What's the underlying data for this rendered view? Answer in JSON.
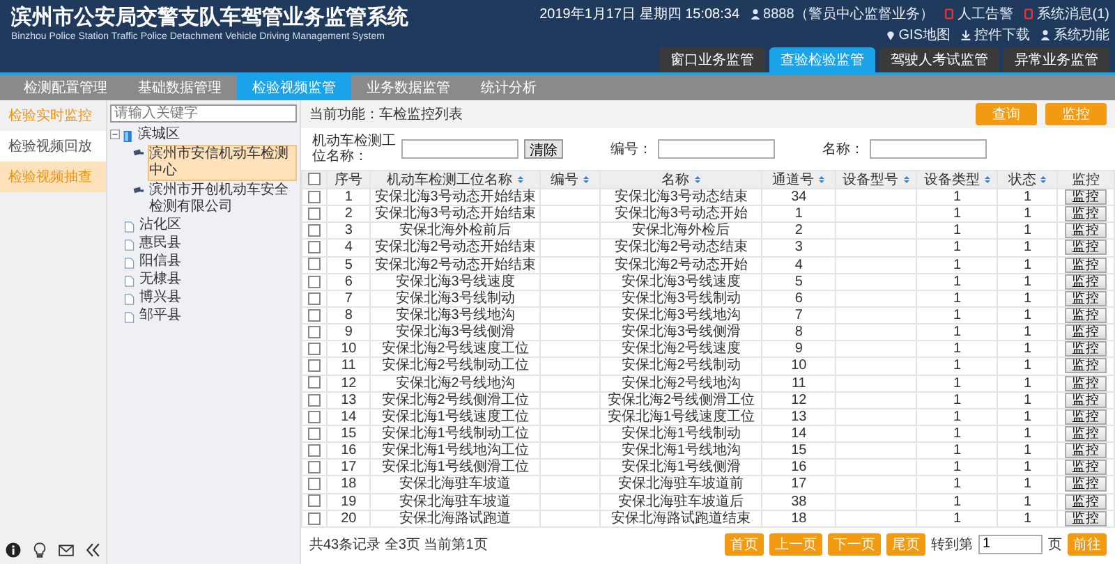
{
  "header": {
    "title": "滨州市公安局交警支队车驾管业务监管系统",
    "subtitle": "Binzhou Police Station Traffic Police Detachment Vehicle Driving Management System",
    "datetime": "2019年1月17日 星期四 15:08:34",
    "links": [
      {
        "kind": "user",
        "label": "8888（警员中心监督业务）"
      },
      {
        "kind": "alarm",
        "label": "人工告警"
      },
      {
        "kind": "message",
        "label": "系统消息(1)"
      },
      {
        "kind": "map",
        "label": "GIS地图"
      },
      {
        "kind": "download",
        "label": "控件下载"
      },
      {
        "kind": "system",
        "label": "系统功能"
      }
    ],
    "tabs": [
      {
        "label": "窗口业务监管",
        "selected": false
      },
      {
        "label": "查验检验监管",
        "selected": true
      },
      {
        "label": "驾驶人考试监管",
        "selected": false
      },
      {
        "label": "异常业务监管",
        "selected": false
      }
    ]
  },
  "nav": {
    "tabs": [
      {
        "label": "检测配置管理",
        "selected": false
      },
      {
        "label": "基础数据管理",
        "selected": false
      },
      {
        "label": "检验视频监管",
        "selected": true
      },
      {
        "label": "业务数据监管",
        "selected": false
      },
      {
        "label": "统计分析",
        "selected": false
      }
    ]
  },
  "sidebar": {
    "items": [
      {
        "label": "检验实时监控",
        "selected": false,
        "hover": true
      },
      {
        "label": "检验视频回放",
        "selected": false,
        "hover": false
      },
      {
        "label": "检验视频抽查",
        "selected": true,
        "hover": false
      }
    ]
  },
  "tree": {
    "placeholder": "请输入关键字",
    "nodes": [
      {
        "label": "滨城区",
        "expanded": true,
        "children": [
          {
            "label": "滨州市安信机动车检测中心",
            "selected": true
          },
          {
            "label": "滨州市开创机动车安全检测有限公司",
            "selected": false
          }
        ]
      },
      {
        "label": "沾化区"
      },
      {
        "label": "惠民县"
      },
      {
        "label": "阳信县"
      },
      {
        "label": "无棣县"
      },
      {
        "label": "博兴县"
      },
      {
        "label": "邹平县"
      }
    ]
  },
  "main": {
    "breadcrumb": "当前功能：车检监控列表",
    "actions": [
      "查询",
      "监控"
    ],
    "filters": [
      {
        "label": "机动车检测工位名称：",
        "button": "清除"
      },
      {
        "label": "编号："
      },
      {
        "label": "名称："
      }
    ],
    "table": {
      "select_all": {
        "checked": false
      },
      "columns": [
        {
          "label": "序号",
          "sortable": false
        },
        {
          "label": "机动车检测工位名称",
          "sortable": true
        },
        {
          "label": "编号",
          "sortable": true
        },
        {
          "label": "名称",
          "sortable": true
        },
        {
          "label": "通道号",
          "sortable": true
        },
        {
          "label": "设备型号",
          "sortable": true
        },
        {
          "label": "设备类型",
          "sortable": true
        },
        {
          "label": "状态",
          "sortable": true
        },
        {
          "label": "监控",
          "sortable": false
        }
      ],
      "rows": [
        {
          "checked": false,
          "index": "1",
          "station": "安保北海3号动态开始结束",
          "name": "安保北海3号动态结束",
          "channel": "34",
          "device_type": "1",
          "status": "1",
          "action": "监控"
        },
        {
          "checked": false,
          "index": "2",
          "station": "安保北海3号动态开始结束",
          "name": "安保北海3号动态开始",
          "channel": "1",
          "device_type": "1",
          "status": "1",
          "action": "监控"
        },
        {
          "checked": false,
          "index": "3",
          "station": "安保北海外检前后",
          "name": "安保北海外检后",
          "channel": "2",
          "device_type": "1",
          "status": "1",
          "action": "监控"
        },
        {
          "checked": false,
          "index": "4",
          "station": "安保北海2号动态开始结束",
          "name": "安保北海2号动态结束",
          "channel": "3",
          "device_type": "1",
          "status": "1",
          "action": "监控"
        },
        {
          "checked": false,
          "index": "5",
          "station": "安保北海2号动态开始结束",
          "name": "安保北海2号动态开始",
          "channel": "4",
          "device_type": "1",
          "status": "1",
          "action": "监控"
        },
        {
          "checked": false,
          "index": "6",
          "station": "安保北海3号线速度",
          "name": "安保北海3号线速度",
          "channel": "5",
          "device_type": "1",
          "status": "1",
          "action": "监控"
        },
        {
          "checked": false,
          "index": "7",
          "station": "安保北海3号线制动",
          "name": "安保北海3号线制动",
          "channel": "6",
          "device_type": "1",
          "status": "1",
          "action": "监控"
        },
        {
          "checked": false,
          "index": "8",
          "station": "安保北海3号线地沟",
          "name": "安保北海3号线地沟",
          "channel": "7",
          "device_type": "1",
          "status": "1",
          "action": "监控"
        },
        {
          "checked": false,
          "index": "9",
          "station": "安保北海3号线侧滑",
          "name": "安保北海3号线侧滑",
          "channel": "8",
          "device_type": "1",
          "status": "1",
          "action": "监控"
        },
        {
          "checked": false,
          "index": "10",
          "station": "安保北海2号线速度工位",
          "name": "安保北海2号线速度",
          "channel": "9",
          "device_type": "1",
          "status": "1",
          "action": "监控"
        },
        {
          "checked": false,
          "index": "11",
          "station": "安保北海2号线制动工位",
          "name": "安保北海2号线制动",
          "channel": "10",
          "device_type": "1",
          "status": "1",
          "action": "监控"
        },
        {
          "checked": false,
          "index": "12",
          "station": "安保北海2号线地沟",
          "name": "安保北海2号线地沟",
          "channel": "11",
          "device_type": "1",
          "status": "1",
          "action": "监控"
        },
        {
          "checked": false,
          "index": "13",
          "station": "安保北海2号线侧滑工位",
          "name": "安保北海2号线侧滑工位",
          "channel": "12",
          "device_type": "1",
          "status": "1",
          "action": "监控"
        },
        {
          "checked": false,
          "index": "14",
          "station": "安保北海1号线速度工位",
          "name": "安保北海1号线速度工位",
          "channel": "13",
          "device_type": "1",
          "status": "1",
          "action": "监控"
        },
        {
          "checked": false,
          "index": "15",
          "station": "安保北海1号线制动工位",
          "name": "安保北海1号线制动",
          "channel": "14",
          "device_type": "1",
          "status": "1",
          "action": "监控"
        },
        {
          "checked": false,
          "index": "16",
          "station": "安保北海1号线地沟工位",
          "name": "安保北海1号线地沟",
          "channel": "15",
          "device_type": "1",
          "status": "1",
          "action": "监控"
        },
        {
          "checked": false,
          "index": "17",
          "station": "安保北海1号线侧滑工位",
          "name": "安保北海1号线侧滑",
          "channel": "16",
          "device_type": "1",
          "status": "1",
          "action": "监控"
        },
        {
          "checked": false,
          "index": "18",
          "station": "安保北海驻车坡道",
          "name": "安保北海驻车坡道前",
          "channel": "17",
          "device_type": "1",
          "status": "1",
          "action": "监控"
        },
        {
          "checked": false,
          "index": "19",
          "station": "安保北海驻车坡道",
          "name": "安保北海驻车坡道后",
          "channel": "38",
          "device_type": "1",
          "status": "1",
          "action": "监控"
        },
        {
          "checked": false,
          "index": "20",
          "station": "安保北海路试跑道",
          "name": "安保北海路试跑道结束",
          "channel": "18",
          "device_type": "1",
          "status": "1",
          "action": "监控"
        }
      ]
    },
    "pagination": {
      "summary": "共43条记录 全3页 当前第1页",
      "buttons": [
        "首页",
        "上一页",
        "下一页",
        "尾页"
      ],
      "goto_label": "转到第",
      "page_value": "1",
      "page_suffix": "页",
      "go": "前往"
    }
  }
}
